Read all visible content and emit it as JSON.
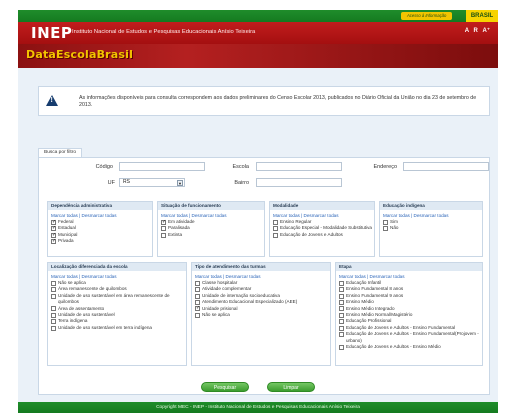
{
  "gov": {
    "access_label": "Acesso à Informação",
    "brasil_label": "BRASIL"
  },
  "header": {
    "logo": "INEP",
    "institute_name": "Instituto Nacional de Estudos e Pesquisas Educacionais Anísio Teixeira",
    "font_controls": [
      "A",
      "R",
      "A⁺"
    ]
  },
  "brand": {
    "title": "DataEscolaBrasil"
  },
  "notice": {
    "text": "As informações disponíveis para consulta correspondem aos dados preliminares do Censo Escolar 2013, publicados no Diário Oficial da União no dia 23 de setembro de 2013."
  },
  "tab": {
    "label": "Busca por filtro"
  },
  "filters": {
    "codigo_label": "Código",
    "codigo_value": "",
    "escola_label": "Escola",
    "escola_value": "",
    "endereco_label": "Endereço",
    "endereco_value": "",
    "uf_label": "UF",
    "uf_value": "RS",
    "bairro_label": "Bairro",
    "bairro_value": ""
  },
  "mark_links": "Marcar todas | Desmarcar todas",
  "panels": {
    "dependencia": {
      "title": "Dependência administrativa",
      "options": [
        {
          "label": "Federal",
          "checked": true
        },
        {
          "label": "Estadual",
          "checked": true
        },
        {
          "label": "Municipal",
          "checked": true
        },
        {
          "label": "Privada",
          "checked": true
        }
      ]
    },
    "situacao": {
      "title": "Situação de funcionamento",
      "options": [
        {
          "label": "Em atividade",
          "checked": true
        },
        {
          "label": "Paralisada",
          "checked": false
        },
        {
          "label": "Extinta",
          "checked": false
        }
      ]
    },
    "modalidade": {
      "title": "Modalidade",
      "options": [
        {
          "label": "Ensino Regular",
          "checked": false
        },
        {
          "label": "Educação Especial - Modalidade Substitutiva",
          "checked": false
        },
        {
          "label": "Educação de Jovens e Adultos",
          "checked": false
        }
      ]
    },
    "indigena": {
      "title": "Educação indígena",
      "options": [
        {
          "label": "Sim",
          "checked": false
        },
        {
          "label": "Não",
          "checked": false
        }
      ]
    },
    "localizacao": {
      "title": "Localização diferenciada da escola",
      "options": [
        {
          "label": "Não se aplica",
          "checked": false
        },
        {
          "label": "Área remanescente de quilombos",
          "checked": false
        },
        {
          "label": "Unidade de uso sustentável em área remanescente de quilombos",
          "checked": false
        },
        {
          "label": "Área de assentamento",
          "checked": false
        },
        {
          "label": "Unidade de uso sustentável",
          "checked": false
        },
        {
          "label": "Terra indígena",
          "checked": false
        },
        {
          "label": "Unidade de uso sustentável em terra indígena",
          "checked": false
        }
      ]
    },
    "atendimento": {
      "title": "Tipo de atendimento das turmas",
      "options": [
        {
          "label": "Classe hospitalar",
          "checked": false
        },
        {
          "label": "Atividade complementar",
          "checked": false
        },
        {
          "label": "Unidade de internação socioeducativa",
          "checked": false
        },
        {
          "label": "Atendimento Educacional Especializado (AEE)",
          "checked": false
        },
        {
          "label": "Unidade prisional",
          "checked": true
        },
        {
          "label": "Não se aplica",
          "checked": false
        }
      ]
    },
    "etapa": {
      "title": "Etapa",
      "options": [
        {
          "label": "Educação Infantil",
          "checked": false
        },
        {
          "label": "Ensino Fundamental 8 anos",
          "checked": false
        },
        {
          "label": "Ensino Fundamental 9 anos",
          "checked": false
        },
        {
          "label": "Ensino Médio",
          "checked": false
        },
        {
          "label": "Ensino Médio Integrado",
          "checked": false
        },
        {
          "label": "Ensino Médio Normal/Magistério",
          "checked": false
        },
        {
          "label": "Educação Profissional",
          "checked": false
        },
        {
          "label": "Educação de Jovens e Adultos - Ensino Fundamental",
          "checked": false
        },
        {
          "label": "Educação de Jovens e Adultos - Ensino Fundamental(Projovem - urbano)",
          "checked": false
        },
        {
          "label": "Educação de Jovens e Adultos - Ensino Médio",
          "checked": false
        }
      ]
    }
  },
  "buttons": {
    "search": "Pesquisar",
    "clear": "Limpar"
  },
  "footer": {
    "text": "Copyright MEC - INEP - Instituto Nacional de Estudos e Pesquisas Educacionais Anísio Teixeira"
  }
}
